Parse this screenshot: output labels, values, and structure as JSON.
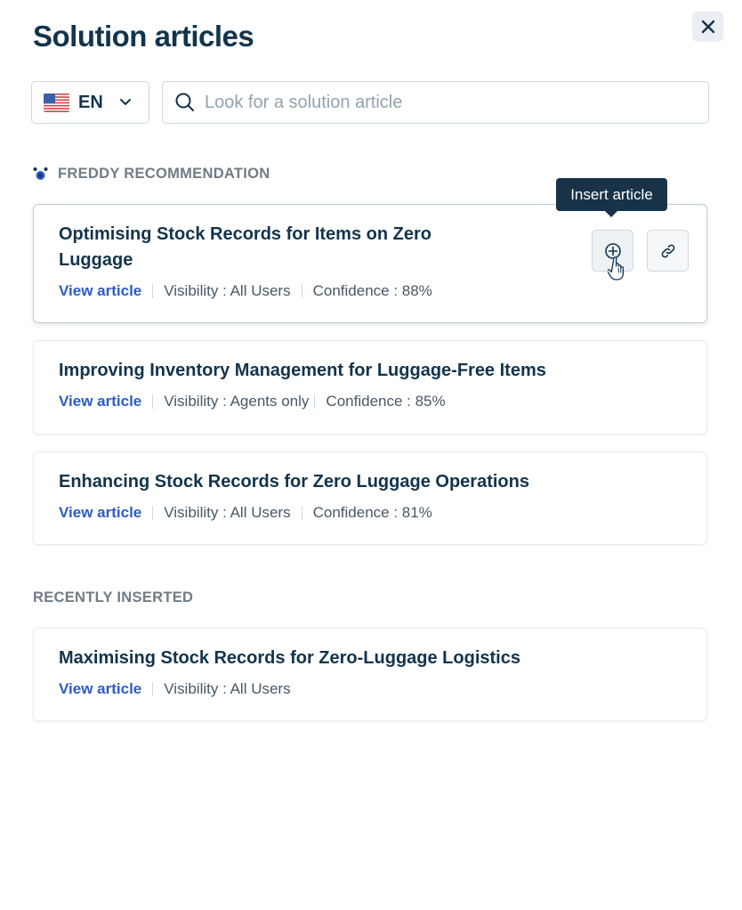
{
  "header": {
    "title": "Solution articles"
  },
  "language": {
    "code": "EN"
  },
  "search": {
    "placeholder": "Look for a solution article",
    "value": ""
  },
  "sections": {
    "recommendation_label": "FREDDY RECOMMENDATION",
    "recent_label": "RECENTLY INSERTED"
  },
  "tooltip": {
    "text": "Insert article"
  },
  "recommended": [
    {
      "title": "Optimising Stock Records for Items on Zero Luggage",
      "link": "View article",
      "visibility": "Visibility : All Users",
      "confidence": "Confidence : 88%"
    },
    {
      "title": "Improving Inventory Management for Luggage-Free Items",
      "link": "View article",
      "visibility": "Visibility : Agents only",
      "confidence": "Confidence : 85%"
    },
    {
      "title": "Enhancing Stock Records for Zero Luggage Operations",
      "link": "View article",
      "visibility": "Visibility : All Users",
      "confidence": "Confidence : 81%"
    }
  ],
  "recent": [
    {
      "title": "Maximising Stock Records for Zero-Luggage Logistics",
      "link": "View article",
      "visibility": "Visibility : All Users"
    }
  ],
  "colors": {
    "primary_text": "#12344d",
    "link": "#2c5cc5",
    "muted": "#6f7c87",
    "tooltip_bg": "#183247"
  }
}
